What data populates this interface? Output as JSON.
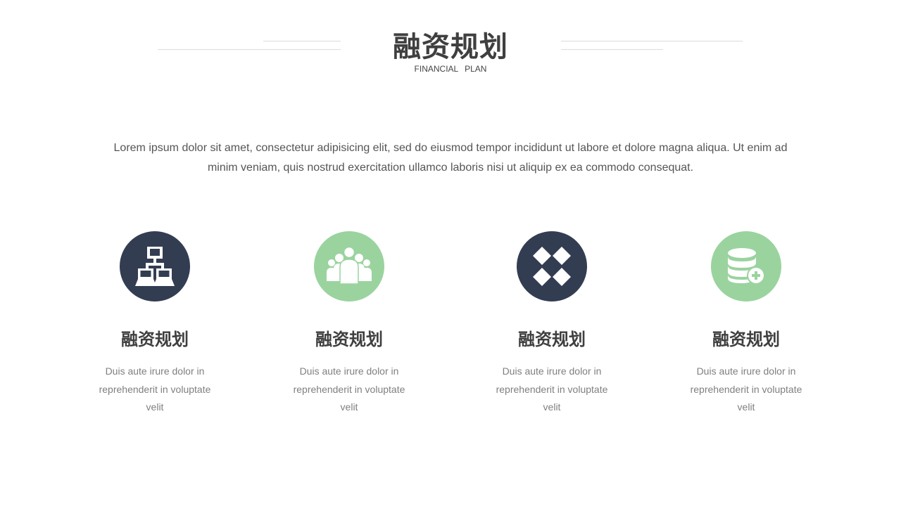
{
  "header": {
    "title": "融资规划",
    "subtitle": "FINANCIAL  PLAN"
  },
  "intro_text": "Lorem ipsum dolor sit amet, consectetur adipisicing elit, sed do eiusmod tempor incididunt ut labore et dolore magna aliqua. Ut enim ad minim veniam, quis nostrud exercitation ullamco laboris nisi ut aliquip ex ea commodo consequat.",
  "colors": {
    "dark": "#333d52",
    "green": "#9ad39e",
    "title_text": "#3f3f3f",
    "body_text": "#7f7f7f"
  },
  "features": [
    {
      "icon": "network-icon",
      "color": "dark",
      "title": "融资规划",
      "text": "Duis aute irure dolor in reprehenderit in voluptate velit"
    },
    {
      "icon": "team-icon",
      "color": "green",
      "title": "融资规划",
      "text": "Duis aute irure dolor in reprehenderit in voluptate velit"
    },
    {
      "icon": "diamonds-icon",
      "color": "dark",
      "title": "融资规划",
      "text": "Duis aute irure dolor in reprehenderit in voluptate velit"
    },
    {
      "icon": "database-add-icon",
      "color": "green",
      "title": "融资规划",
      "text": "Duis aute irure dolor in reprehenderit in voluptate velit"
    }
  ]
}
